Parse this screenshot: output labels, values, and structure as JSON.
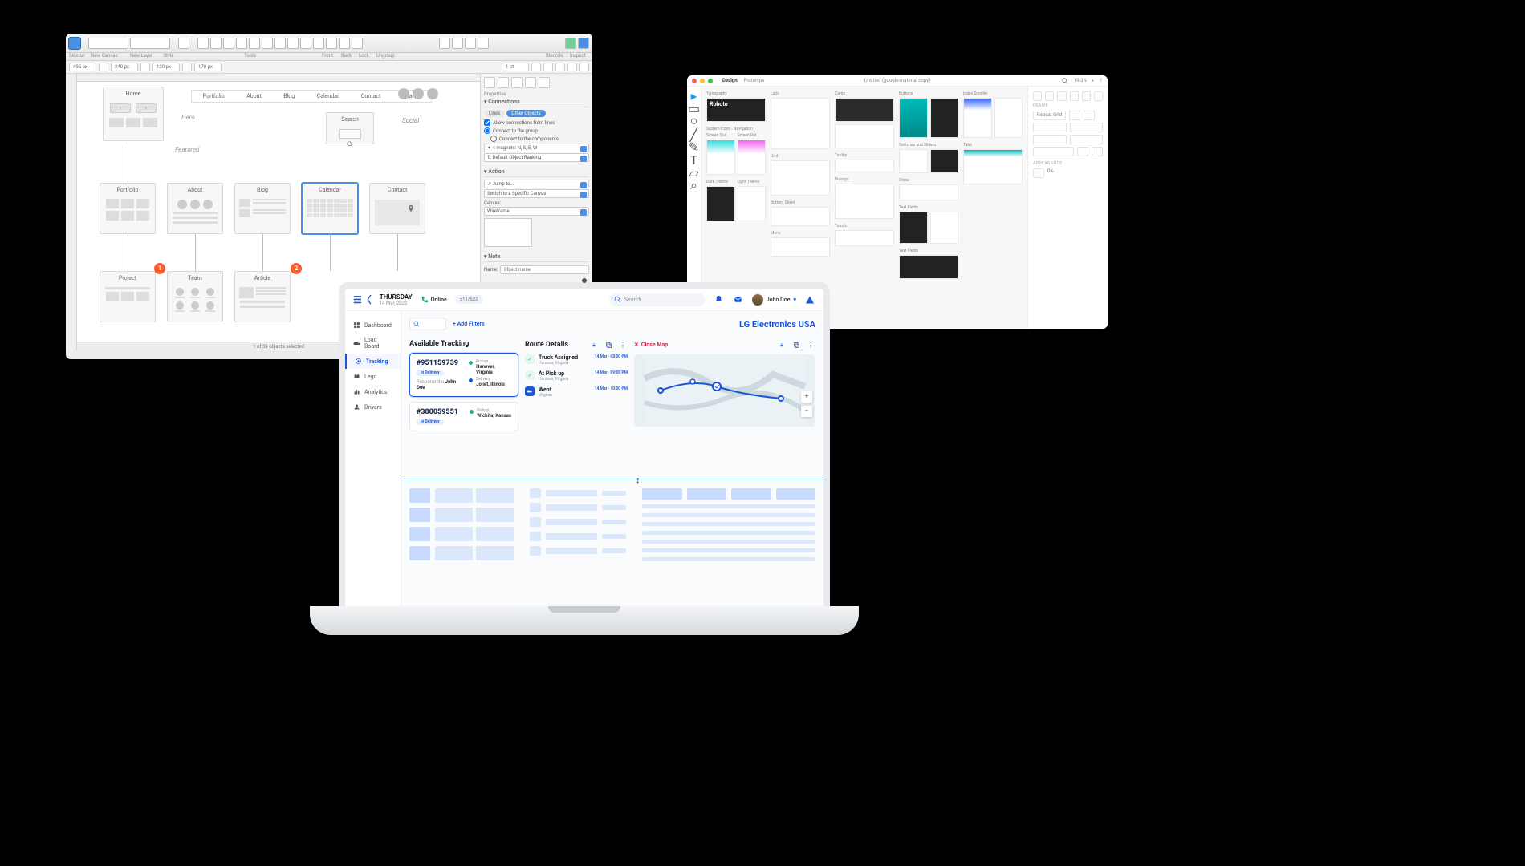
{
  "wireframe": {
    "toolbar_labels": {
      "sidebar": "Sidebar",
      "new_canvas": "New Canvas",
      "new_layer": "New Layer",
      "style": "Style",
      "tools": "Tools",
      "front": "Front",
      "back": "Back",
      "lock": "Lock",
      "ungroup": "Ungroup",
      "stencils": "Stencils",
      "inspect": "Inspect"
    },
    "subbar": {
      "x": "495 px",
      "y": "240 px",
      "w": "130 px",
      "h": "170 px",
      "stroke": "1 pt"
    },
    "nav": [
      "Portfolio",
      "About",
      "Blog",
      "Calendar",
      "Contact",
      "Search"
    ],
    "home": "Home",
    "hero": "Hero",
    "featured": "Featured",
    "social": "Social",
    "search": "Search",
    "cards": {
      "portfolio": "Portfolio",
      "about": "About",
      "blog": "Blog",
      "calendar": "Calendar",
      "contact": "Contact",
      "project": "Project",
      "team": "Team",
      "article": "Article"
    },
    "badges": {
      "b1": "1",
      "b2": "2"
    },
    "status": "1 of 39 objects selected",
    "inspector": {
      "properties": "Properties",
      "connections": "Connections",
      "lines": "Lines",
      "other": "Other Objects",
      "allow": "Allow connections from lines",
      "connect_group": "Connect to the group",
      "connect_comp": "Connect to the components",
      "magnets": "4 magnets: N, S, E, W",
      "ranking": "Default Object Ranking",
      "action": "Action",
      "jump": "Jump to...",
      "switch": "Switch to a Specific Canvas",
      "canvas_lbl": "Canvas:",
      "canvas_val": "Wireframe",
      "note": "Note",
      "name": "Name:",
      "name_ph": "Object name"
    }
  },
  "figma": {
    "tabs": {
      "design": "Design",
      "prototype": "Prototype"
    },
    "title": "Untitled (google-material copy)",
    "zoom": "19.3%",
    "sections": {
      "typography": "Typography",
      "roboto": "Roboto",
      "system_icons": "System Icons - Navigation",
      "screen_qui": "Screen Qui...",
      "screen_rat": "Screen Rat...",
      "dark_theme": "Dark Theme",
      "light_theme": "Light Theme",
      "lists": "Lists",
      "grid": "Grid",
      "bottom_sheet": "Bottom Sheet",
      "menu": "Menu",
      "cards": "Cards",
      "dialogs": "Dialogs",
      "toasts": "Toasts",
      "buttons": "Buttons",
      "switches": "Switches and Sliders",
      "chips": "Chips",
      "text_fields": "Text Fields",
      "tooltip": "Tooltip",
      "index_scroller": "Index Scroller",
      "tabs": "Tabs",
      "text_fields2": "Text Fields"
    },
    "panel": {
      "frame": "FRAME",
      "repeat_grid": "Repeat Grid",
      "appearance": "APPEARANCE",
      "opacity": "0%"
    }
  },
  "tracker": {
    "day": "THURSDAY",
    "date": "14 Mar, 2022",
    "online": "Online",
    "count": "511/522",
    "search": "Search",
    "user": "John Doe",
    "nav": {
      "dashboard": "Dashboard",
      "loadboard": "Load Board",
      "tracking": "Tracking",
      "lego": "Lego",
      "analytics": "Analytics",
      "drivers": "Drivers"
    },
    "add_filters": "Add Filters",
    "company": "LG Electronics USA",
    "available": "Available Tracking",
    "route_details": "Route Details",
    "close_map": "Close Map",
    "cards": [
      {
        "id": "#951159739",
        "badge": "In Delivery",
        "resp_lbl": "Responsible:",
        "resp": "John Doe",
        "pickup_lbl": "Pickup",
        "pickup": "Hanover, Virginia",
        "delivery_lbl": "Delivery",
        "delivery": "Joliet, Illinois"
      },
      {
        "id": "#380059551",
        "badge": "In Delivery",
        "pickup_lbl": "Pickup",
        "pickup": "Wichita, Kansas"
      }
    ],
    "steps": [
      {
        "title": "Truck Assigned",
        "sub": "Hanover, Virginia",
        "time": "14 Mar · 08:00 PM"
      },
      {
        "title": "At Pick up",
        "sub": "Hanover, Virginia",
        "time": "14 Mar · 09:00 PM"
      },
      {
        "title": "Went",
        "sub": "Virginia",
        "time": "14 Mar · 10:00 PM"
      }
    ]
  }
}
